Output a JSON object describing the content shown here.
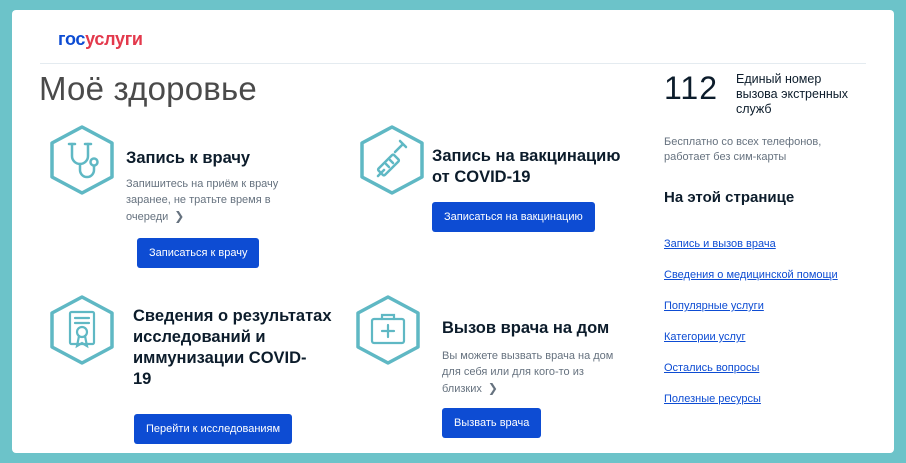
{
  "brand": {
    "logo_gos": "гос",
    "logo_uslugi": "услуги"
  },
  "page": {
    "title": "Моё здоровье"
  },
  "cards": [
    {
      "icon": "stethoscope-icon",
      "title": "Запись к врачу",
      "desc_lines": [
        "Запишитесь на приём к врачу",
        "заранее, не тратьте время в",
        "очереди"
      ],
      "button": "Записаться к врачу"
    },
    {
      "icon": "syringe-icon",
      "title_lines": [
        "Запись на вакцинацию",
        "от COVID-19"
      ],
      "button": "Записаться на вакцинацию"
    },
    {
      "icon": "certificate-icon",
      "title_lines": [
        "Сведения о результатах",
        "исследований и",
        "иммунизации COVID-",
        "19"
      ],
      "button": "Перейти к исследованиям"
    },
    {
      "icon": "medical-kit-icon",
      "title": "Вызов врача на дом",
      "desc_lines": [
        "Вы можете вызвать врача на дом",
        "для себя или для кого-то из",
        "близких"
      ],
      "button": "Вызвать врача"
    }
  ],
  "emergency": {
    "number": "112",
    "label_lines": [
      "Единый номер",
      "вызова экстренных",
      "служб"
    ],
    "note_lines": [
      "Бесплатно со всех телефонов,",
      "работает без сим-карты"
    ]
  },
  "on_page": {
    "title": "На этой странице",
    "links": [
      "Запись и вызов врача",
      "Сведения о медицинской помощи",
      "Популярные услуги",
      "Категории услуг",
      "Остались вопросы",
      "Полезные ресурсы"
    ]
  },
  "colors": {
    "accent": "#0d4cd3",
    "brand_red": "#e3394c",
    "icon_teal": "#5fb8c4",
    "frame": "#6cc3c9"
  }
}
